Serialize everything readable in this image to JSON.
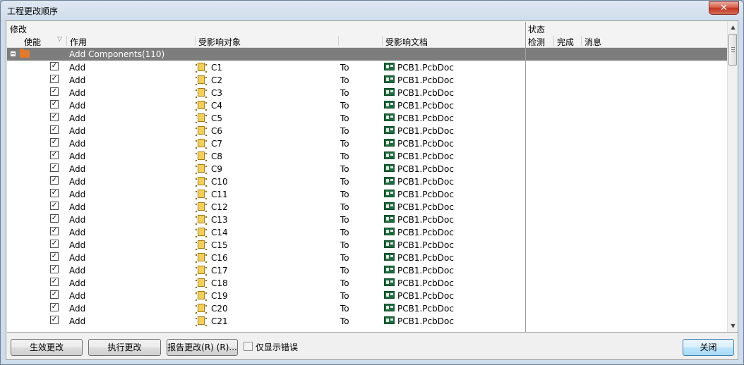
{
  "window": {
    "title": "工程更改顺序"
  },
  "header": {
    "modify": "修改",
    "status": "状态",
    "enable": "使能",
    "action": "作用",
    "affected_object": "受影响对象",
    "affected_doc": "受影响文档",
    "check": "检测",
    "done": "完成",
    "message": "消息"
  },
  "group": {
    "label": "Add Components(110)"
  },
  "rows": [
    {
      "action": "Add",
      "object": "C1",
      "to": "To",
      "doc": "PCB1.PcbDoc"
    },
    {
      "action": "Add",
      "object": "C2",
      "to": "To",
      "doc": "PCB1.PcbDoc"
    },
    {
      "action": "Add",
      "object": "C3",
      "to": "To",
      "doc": "PCB1.PcbDoc"
    },
    {
      "action": "Add",
      "object": "C4",
      "to": "To",
      "doc": "PCB1.PcbDoc"
    },
    {
      "action": "Add",
      "object": "C5",
      "to": "To",
      "doc": "PCB1.PcbDoc"
    },
    {
      "action": "Add",
      "object": "C6",
      "to": "To",
      "doc": "PCB1.PcbDoc"
    },
    {
      "action": "Add",
      "object": "C7",
      "to": "To",
      "doc": "PCB1.PcbDoc"
    },
    {
      "action": "Add",
      "object": "C8",
      "to": "To",
      "doc": "PCB1.PcbDoc"
    },
    {
      "action": "Add",
      "object": "C9",
      "to": "To",
      "doc": "PCB1.PcbDoc"
    },
    {
      "action": "Add",
      "object": "C10",
      "to": "To",
      "doc": "PCB1.PcbDoc"
    },
    {
      "action": "Add",
      "object": "C11",
      "to": "To",
      "doc": "PCB1.PcbDoc"
    },
    {
      "action": "Add",
      "object": "C12",
      "to": "To",
      "doc": "PCB1.PcbDoc"
    },
    {
      "action": "Add",
      "object": "C13",
      "to": "To",
      "doc": "PCB1.PcbDoc"
    },
    {
      "action": "Add",
      "object": "C14",
      "to": "To",
      "doc": "PCB1.PcbDoc"
    },
    {
      "action": "Add",
      "object": "C15",
      "to": "To",
      "doc": "PCB1.PcbDoc"
    },
    {
      "action": "Add",
      "object": "C16",
      "to": "To",
      "doc": "PCB1.PcbDoc"
    },
    {
      "action": "Add",
      "object": "C17",
      "to": "To",
      "doc": "PCB1.PcbDoc"
    },
    {
      "action": "Add",
      "object": "C18",
      "to": "To",
      "doc": "PCB1.PcbDoc"
    },
    {
      "action": "Add",
      "object": "C19",
      "to": "To",
      "doc": "PCB1.PcbDoc"
    },
    {
      "action": "Add",
      "object": "C20",
      "to": "To",
      "doc": "PCB1.PcbDoc"
    },
    {
      "action": "Add",
      "object": "C21",
      "to": "To",
      "doc": "PCB1.PcbDoc"
    }
  ],
  "buttons": {
    "validate": "生效更改",
    "execute": "执行更改",
    "report": "报告更改(R) (R)...",
    "close": "关闭"
  },
  "show_errors_only": {
    "label": "仅显示错误",
    "checked": false
  },
  "colors": {
    "group_row": "#7d7d7d",
    "default_button": "#a7d9f5"
  }
}
